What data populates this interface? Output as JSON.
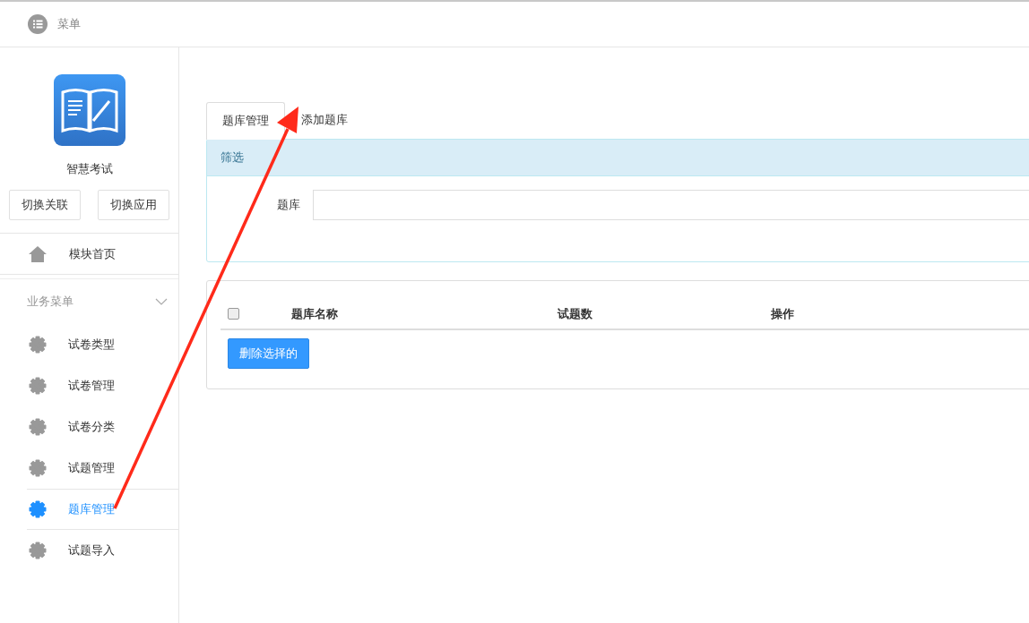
{
  "top_bar": {
    "menu_label": "菜单"
  },
  "sidebar": {
    "app_name": "智慧考试",
    "buttons": [
      "切换关联",
      "切换应用"
    ],
    "home": {
      "label": "模块首页"
    },
    "group": {
      "label": "业务菜单",
      "expanded": true,
      "items": [
        {
          "label": "试卷类型",
          "selected": false
        },
        {
          "label": "试卷管理",
          "selected": false
        },
        {
          "label": "试卷分类",
          "selected": false
        },
        {
          "label": "试题管理",
          "selected": false
        },
        {
          "label": "题库管理",
          "selected": true
        },
        {
          "label": "试题导入",
          "selected": false
        }
      ]
    }
  },
  "tabs": [
    {
      "label": "题库管理",
      "selected": true
    },
    {
      "label": "添加题库",
      "selected": false
    }
  ],
  "filter": {
    "title": "筛选",
    "field_label": "题库"
  },
  "table": {
    "select_all_checked": false,
    "columns": [
      "题库名称",
      "试题数",
      "操作"
    ],
    "delete_button": "删除选择的"
  }
}
